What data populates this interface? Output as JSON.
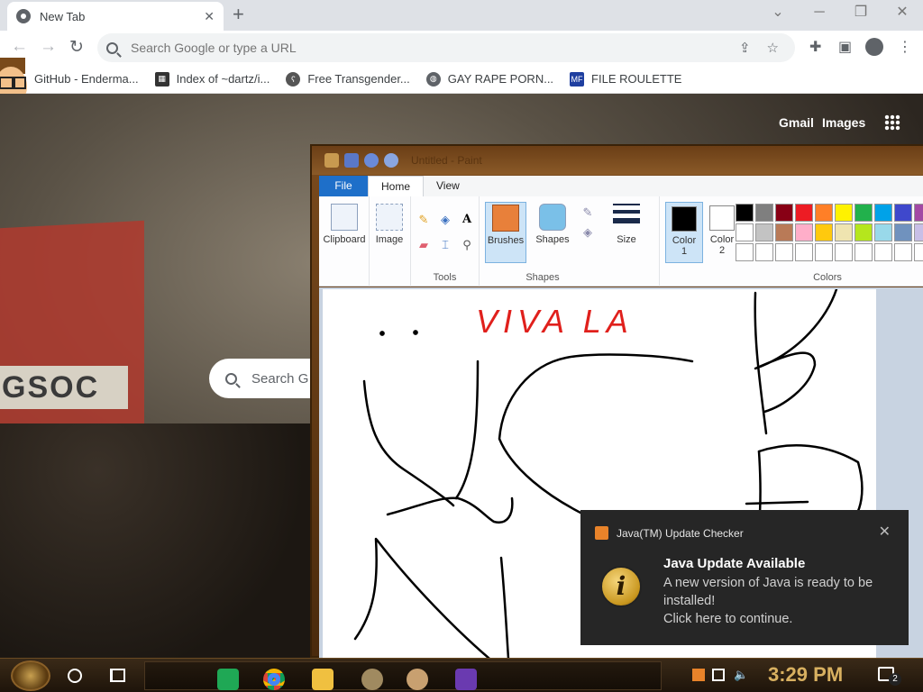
{
  "browser": {
    "tab_title": "New Tab",
    "omnibox_placeholder": "Search Google or type a URL",
    "bookmarks": [
      {
        "label": "GitHub - Enderma...",
        "icon": "github-icon"
      },
      {
        "label": "Index of ~dartz/i...",
        "icon": "grid-icon"
      },
      {
        "label": "Free Transgender...",
        "icon": "bear-icon"
      },
      {
        "label": "GAY RAPE PORN...",
        "icon": "globe-icon"
      },
      {
        "label": "FILE ROULETTE",
        "icon": "mft-icon"
      }
    ]
  },
  "ntp": {
    "gmail": "Gmail",
    "images": "Images",
    "search_placeholder": "Search G",
    "background_sign_text": "GSOC"
  },
  "paint": {
    "title": "Untitled - Paint",
    "menu": {
      "file": "File",
      "home": "Home",
      "view": "View"
    },
    "groups": {
      "clipboard": "Clipboard",
      "image": "Image",
      "tools": "Tools",
      "brushes": "Brushes",
      "shapes_btn": "Shapes",
      "shapes_group": "Shapes",
      "size": "Size",
      "colors": "Colors"
    },
    "color1_label": "Color",
    "color1_num": "1",
    "color2_label": "Color",
    "color2_num": "2",
    "color1": "#000000",
    "color2": "#ffffff",
    "palette": [
      "#000000",
      "#7f7f7f",
      "#880015",
      "#ed1c24",
      "#ff7f27",
      "#fff200",
      "#22b14c",
      "#00a2e8",
      "#3f48cc",
      "#a349a4",
      "#ffffff",
      "#c3c3c3",
      "#b97a57",
      "#ffaec9",
      "#ffc90e",
      "#efe4b0",
      "#b5e61d",
      "#99d9ea",
      "#7092be",
      "#c8bfe7",
      "#ffffff",
      "#ffffff",
      "#ffffff",
      "#ffffff",
      "#ffffff",
      "#ffffff",
      "#ffffff",
      "#ffffff",
      "#ffffff",
      "#ffffff"
    ],
    "canvas_text": "VIVA LA"
  },
  "toast": {
    "app": "Java(TM) Update Checker",
    "heading": "Java Update Available",
    "line1": "A new version of Java is ready to be installed!",
    "line2": "Click here to continue."
  },
  "taskbar": {
    "time": "3:29 PM",
    "notification_count": "2"
  }
}
